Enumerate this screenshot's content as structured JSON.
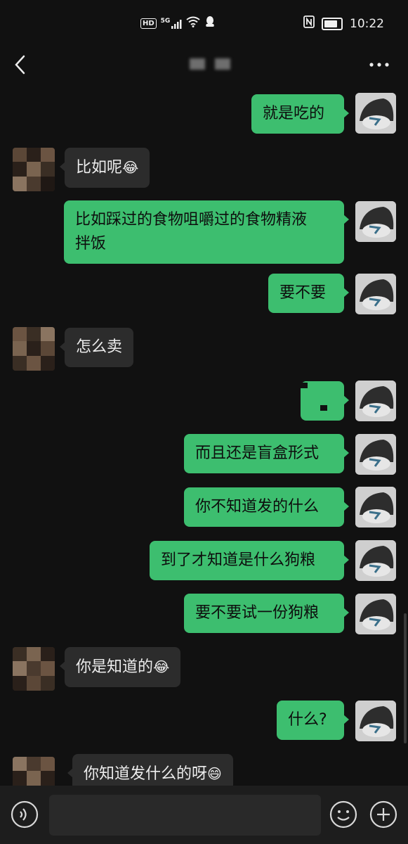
{
  "status_bar": {
    "left_icons": [
      "hd-icon",
      "signal-5g-icon",
      "wifi-icon",
      "qq-icon"
    ],
    "hd_label": "HD",
    "network_label": "5G",
    "right_icons": [
      "nfc-icon",
      "battery-icon"
    ],
    "time": "10:22"
  },
  "nav": {
    "back_icon": "chevron-left-icon",
    "more_icon": "more-dots-icon"
  },
  "messages": [
    {
      "side": "right",
      "text": "就是吃的"
    },
    {
      "side": "left",
      "text": "比如呢",
      "emoji": "😂"
    },
    {
      "side": "right",
      "text": "比如踩过的食物咀嚼过的食物精液",
      "text2": "拌饭"
    },
    {
      "side": "right",
      "text": "要不要"
    },
    {
      "side": "left",
      "text": "怎么卖"
    },
    {
      "side": "right",
      "text": ""
    },
    {
      "side": "right",
      "text": "而且还是盲盒形式"
    },
    {
      "side": "right",
      "text": "你不知道发的什么"
    },
    {
      "side": "right",
      "text": "到了才知道是什么狗粮"
    },
    {
      "side": "right",
      "text": "要不要试一份狗粮"
    },
    {
      "side": "left",
      "text": "你是知道的",
      "emoji": "😂"
    },
    {
      "side": "right",
      "text": "什么?"
    },
    {
      "side": "left",
      "text": "你知道发什么的呀",
      "emoji": "😄"
    }
  ],
  "input_bar": {
    "voice_icon": "voice-icon",
    "emoji_icon": "emoji-icon",
    "plus_icon": "plus-icon",
    "text_value": ""
  },
  "colors": {
    "background": "#111111",
    "sent_bubble": "#3dbe6f",
    "received_bubble": "#2c2c2c"
  }
}
